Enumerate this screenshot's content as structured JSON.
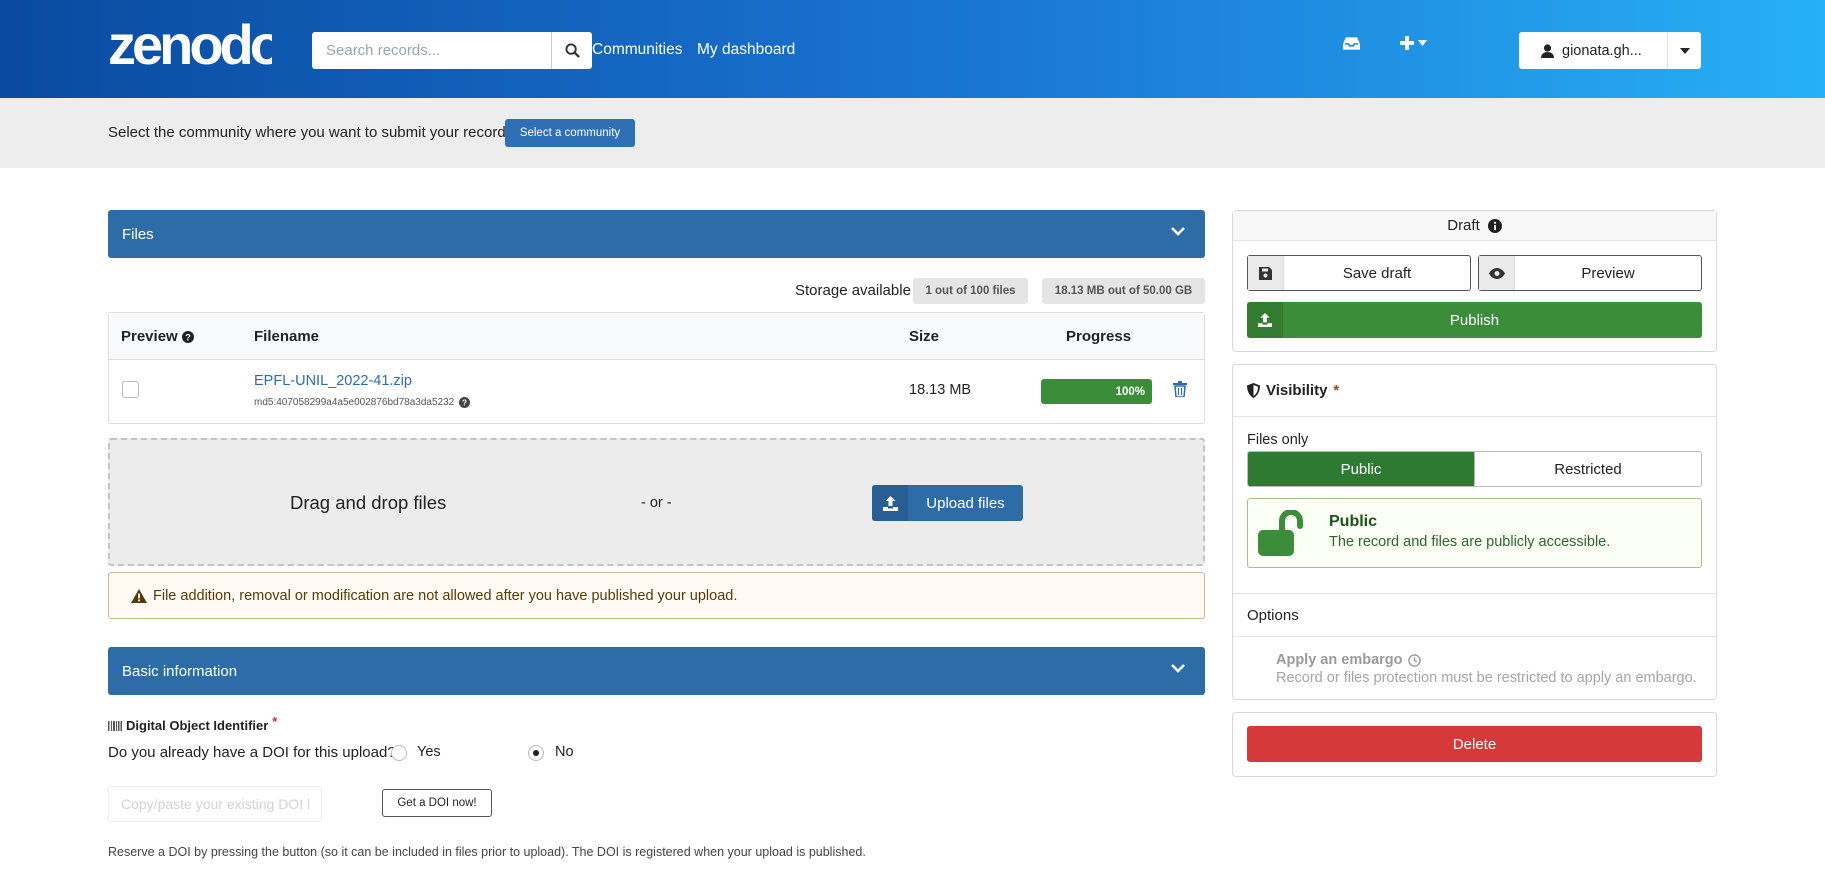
{
  "header": {
    "logo_text": "zenodo",
    "search_placeholder": "Search records...",
    "nav": [
      "Communities",
      "My dashboard"
    ],
    "user_name": "gionata.gh..."
  },
  "banner": {
    "text": "Select the community where you want to submit your record.",
    "button_label": "Select a community"
  },
  "files": {
    "section_title": "Files",
    "storage_label": "Storage available",
    "files_count": "1 out of 100 files",
    "storage_used": "18.13 MB out of 50.00 GB",
    "columns": [
      "Preview",
      "Filename",
      "Size",
      "Progress"
    ],
    "rows": [
      {
        "filename": "EPFL-UNIL_2022-41.zip",
        "md5": "md5:407058299a4a5e002876bd78a3da5232",
        "size": "18.13 MB",
        "progress_label": "100%",
        "progress_fraction": 1.0
      }
    ],
    "dropzone_text": "Drag and drop files",
    "dropzone_or": "- or -",
    "upload_label": "Upload files",
    "warning": "File addition, removal or modification are not allowed after you have published your upload."
  },
  "basic": {
    "section_title": "Basic information",
    "doi_title": "Digital Object Identifier",
    "required_mark": "*",
    "doi_question": "Do you already have a DOI for this upload?",
    "doi_options": [
      "Yes",
      "No"
    ],
    "doi_selected": "No",
    "doi_placeholder": "Copy/paste your existing DOI here",
    "doi_button": "Get a DOI now!",
    "doi_help": "Reserve a DOI by pressing the button (so it can be included in files prior to upload). The DOI is registered when your upload is published."
  },
  "sidebar": {
    "status": "Draft",
    "save_label": "Save draft",
    "preview_label": "Preview",
    "publish_label": "Publish",
    "visibility_title": "Visibility",
    "files_only_label": "Files only",
    "access_options": [
      "Public",
      "Restricted"
    ],
    "access_selected": "Public",
    "public_title": "Public",
    "public_desc": "The record and files are publicly accessible.",
    "options_label": "Options",
    "embargo_title": "Apply an embargo",
    "embargo_desc": "Record or files protection must be restricted to apply an embargo.",
    "delete_label": "Delete"
  },
  "colors": {
    "header_start": "#0a4aa0",
    "header_end": "#27b0f5",
    "primary": "#2e6ca8",
    "success": "#3c8d3a",
    "danger": "#d5393a"
  },
  "icons": [
    "search-icon",
    "inbox-icon",
    "plus-icon",
    "user-icon",
    "chevron-down-icon",
    "question-icon",
    "trash-icon",
    "upload-icon",
    "warning-icon",
    "barcode-icon",
    "info-icon",
    "save-icon",
    "eye-icon",
    "shield-icon",
    "unlock-icon",
    "clock-icon"
  ]
}
